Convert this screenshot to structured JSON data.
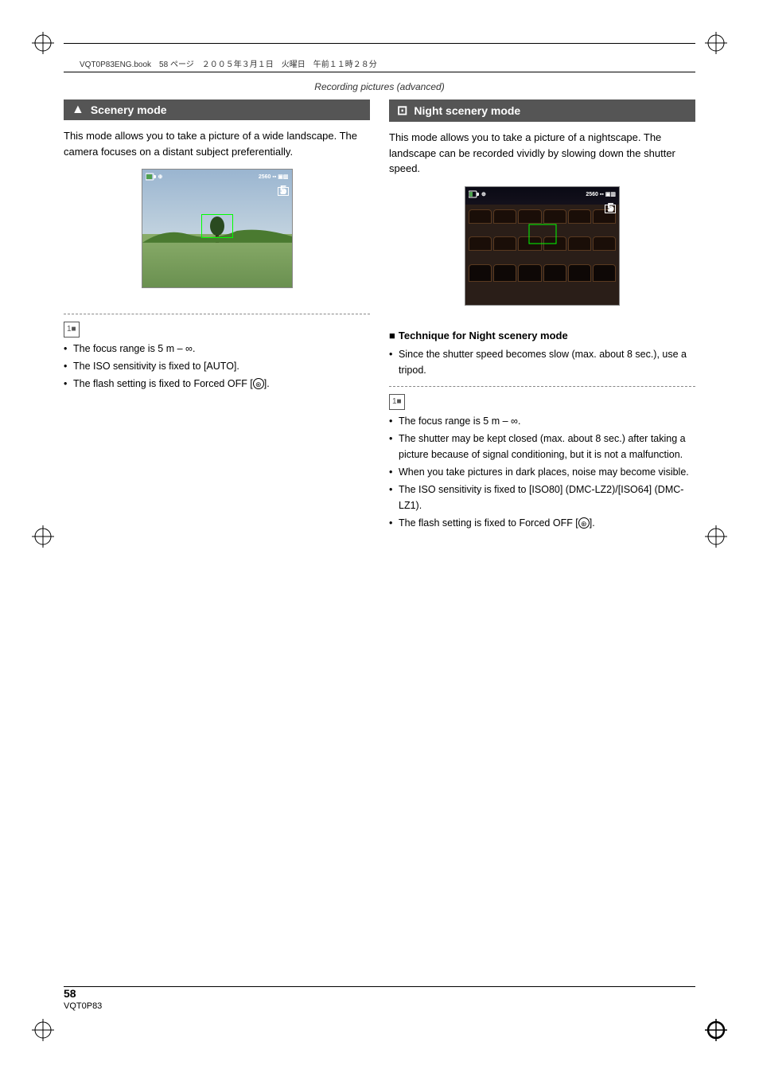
{
  "page": {
    "number": "58",
    "code": "VQT0P83",
    "subtitle": "Recording pictures (advanced)",
    "header_meta": "VQT0P83ENG.book　58 ページ　２００５年３月１日　火曜日　午前１１時２８分"
  },
  "scenery": {
    "header": "Scenery mode",
    "icon": "▲",
    "description": "This mode allows you to take a picture of a wide landscape. The camera focuses on a distant subject preferentially.",
    "note_icon": "1■",
    "bullets": [
      "The focus range is 5 m – ∞.",
      "The ISO sensitivity is fixed to [AUTO].",
      "The flash setting is fixed to Forced OFF [⊛]."
    ],
    "preview": {
      "resolution": "2560",
      "count": "5"
    }
  },
  "night_scenery": {
    "header": "Night scenery mode",
    "icon": "⊡",
    "description": "This mode allows you to take a picture of a nightscape. The landscape can be recorded vividly by slowing down the shutter speed.",
    "technique_header": "Technique for Night scenery mode",
    "technique_bullet": "Since the shutter speed becomes slow (max. about 8 sec.), use a tripod.",
    "note_icon": "1■",
    "bullets": [
      "The focus range is 5 m – ∞.",
      "The shutter may be kept closed (max. about 8 sec.) after taking a picture because of signal conditioning, but it is not a malfunction.",
      "When you take pictures in dark places, noise may become visible.",
      "The ISO sensitivity is fixed to [ISO80] (DMC-LZ2)/[ISO64] (DMC-LZ1).",
      "The flash setting is fixed to Forced OFF [⊛]."
    ],
    "preview": {
      "resolution": "2560",
      "count": "5"
    }
  }
}
